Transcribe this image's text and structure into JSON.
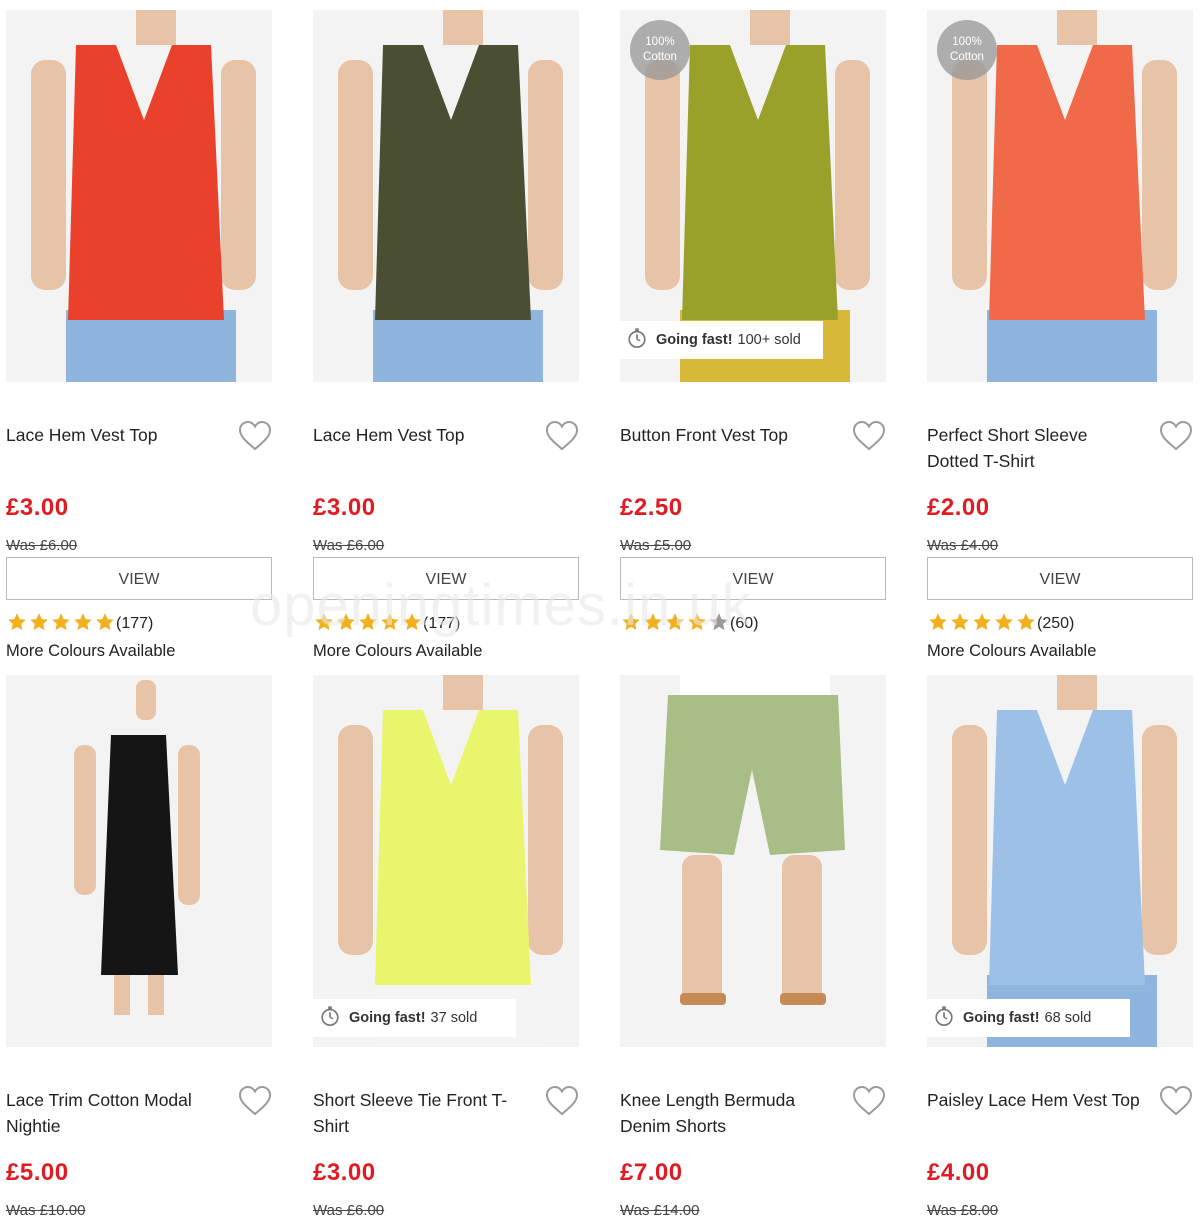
{
  "watermark": "openingtimes.in.uk",
  "colors": {
    "price": "#e11b22",
    "star": "#f2b01e",
    "star_empty": "#9a9a9a"
  },
  "products": [
    {
      "name": "Lace Hem Vest Top",
      "price": "£3.00",
      "was": "Was £6.00",
      "view": "VIEW",
      "rating_count": "(177)",
      "rating": 5,
      "more": "More Colours Available",
      "badge": "",
      "going_fast": null,
      "garment_color": "#e9412b",
      "bottom_color": "#8fb5df"
    },
    {
      "name": "Lace Hem Vest Top",
      "price": "£3.00",
      "was": "Was £6.00",
      "view": "VIEW",
      "rating_count": "(177)",
      "rating": 5,
      "more": "More Colours Available",
      "badge": "",
      "going_fast": null,
      "garment_color": "#4a4f34",
      "bottom_color": "#8fb5df"
    },
    {
      "name": "Button Front Vest Top",
      "price": "£2.50",
      "was": "Was £5.00",
      "view": "VIEW",
      "rating_count": "(60)",
      "rating": 4,
      "more": "",
      "badge_line1": "100%",
      "badge_line2": "Cotton",
      "going_fast": {
        "label": "Going fast!",
        "sold": "100+ sold"
      },
      "garment_color": "#9aa12b",
      "bottom_color": "#d8b838"
    },
    {
      "name": "Perfect Short Sleeve Dotted T-Shirt",
      "price": "£2.00",
      "was": "Was £4.00",
      "view": "VIEW",
      "rating_count": "(250)",
      "rating": 5,
      "more": "More Colours Available",
      "badge_line1": "100%",
      "badge_line2": "Cotton",
      "going_fast": null,
      "garment_color": "#f06a4a",
      "bottom_color": "#8fb5df"
    },
    {
      "name": "Lace Trim Cotton Modal Nightie",
      "price": "£5.00",
      "was": "Was £10.00",
      "going_fast": null,
      "garment_color": "#151515",
      "bottom_color": "#e0c2a8"
    },
    {
      "name": "Short Sleeve Tie Front T-Shirt",
      "price": "£3.00",
      "was": "Was £6.00",
      "going_fast": {
        "label": "Going fast!",
        "sold": "37 sold"
      },
      "garment_color": "#eaf56e",
      "bottom_color": "#f4f4f4"
    },
    {
      "name": "Knee Length Bermuda Denim Shorts",
      "price": "£7.00",
      "was": "Was £14.00",
      "going_fast": null,
      "garment_color": "#a9be87",
      "bottom_color": "#e2c3a9"
    },
    {
      "name": "Paisley Lace Hem Vest Top",
      "price": "£4.00",
      "was": "Was £8.00",
      "going_fast": {
        "label": "Going fast!",
        "sold": "68 sold"
      },
      "garment_color": "#9cc0e6",
      "bottom_color": "#8fb5df"
    }
  ]
}
